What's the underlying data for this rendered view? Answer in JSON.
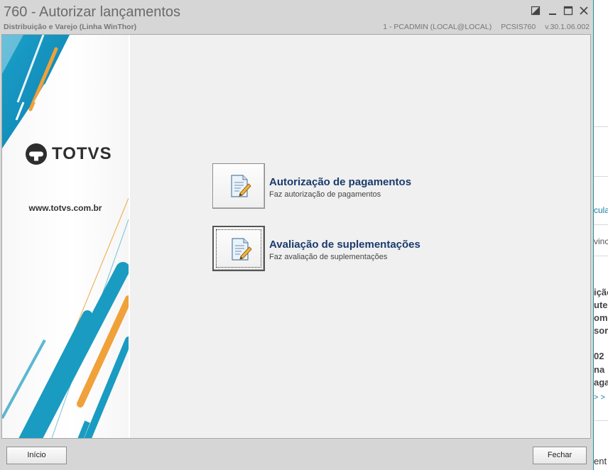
{
  "window": {
    "title": "760 - Autorizar lançamentos",
    "subtitle": "Distribuição e Varejo (Linha WinThor)",
    "user": "1 - PCADMIN (LOCAL@LOCAL)",
    "module": "PCSIS760",
    "version": "v.30.1.06.002",
    "controls": {
      "restore_icon": "restore-icon",
      "minimize_icon": "minimize-icon",
      "maximize_icon": "maximize-icon",
      "close_icon": "close-icon"
    }
  },
  "banner": {
    "logo_text": "TOTVS",
    "website": "www.totvs.com.br",
    "colors": {
      "teal": "#1a9bc1",
      "orange": "#f0a13a"
    }
  },
  "actions": [
    {
      "label": "Autorização de pagamentos",
      "description": "Faz autorização de pagamentos",
      "icon": "edit-document-icon"
    },
    {
      "label": "Avaliação de suplementações",
      "description": "Faz avaliação de suplementações",
      "icon": "edit-document-icon"
    }
  ],
  "footer": {
    "start_label": "Início",
    "close_label": "Fechar"
  },
  "background_window": {
    "fragments": [
      "cula",
      "vinc",
      "ição",
      "ute",
      "omi",
      "sor",
      "02",
      "na",
      "aga",
      "> >",
      "ent"
    ]
  }
}
